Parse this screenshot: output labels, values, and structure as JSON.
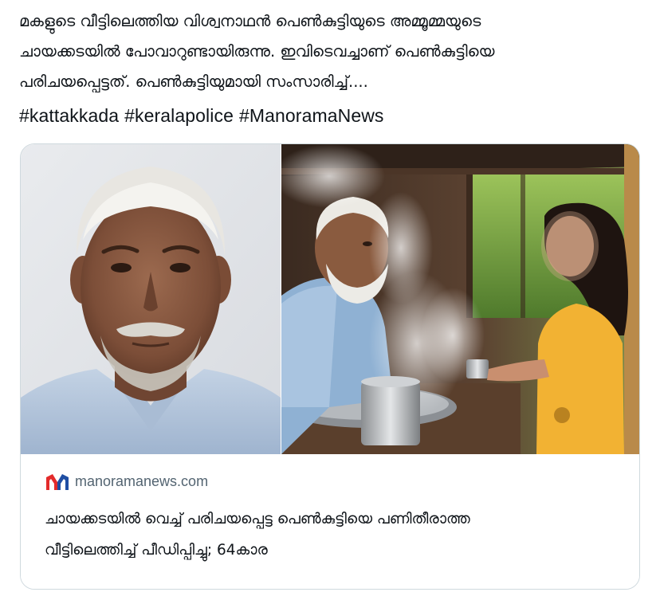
{
  "tweet": {
    "lines": [
      "മകളുടെ വീട്ടിലെത്തിയ വിശ്വനാഥന്‍  പെണ്‍കുട്ടിയുടെ അമ്മൂമ്മയുടെ",
      "ചായക്കടയില്‍ പോവാറുണ്ടായിരുന്നു. ഇവിടെവച്ചാണ് പെണ്‍കുട്ടിയെ",
      "പരിചയപ്പെട്ടത്. പെണ്‍കുട്ടിയുമായി സംസാരിച്ച്...."
    ],
    "hashtags": [
      "#kattakkada",
      "#keralapolice",
      "#ManoramaNews"
    ]
  },
  "card": {
    "source": "manoramanews.com",
    "title_lines": [
      "ചായക്കടയില്‍ വെച്ച് പരിചയപ്പെട്ട പെണ്‍കുട്ടിയെ പണിതീരാത്ത",
      "വീട്ടിലെത്തിച്ച് പീഡിപ്പിച്ചു; 64കാര"
    ]
  },
  "colors": {
    "text": "#0f1419",
    "muted": "#536471",
    "border": "#cfd9de",
    "logo_red": "#e32b2b",
    "logo_blue": "#1f4ea3"
  },
  "icons": {
    "source_logo": "manorama-news-logo"
  }
}
